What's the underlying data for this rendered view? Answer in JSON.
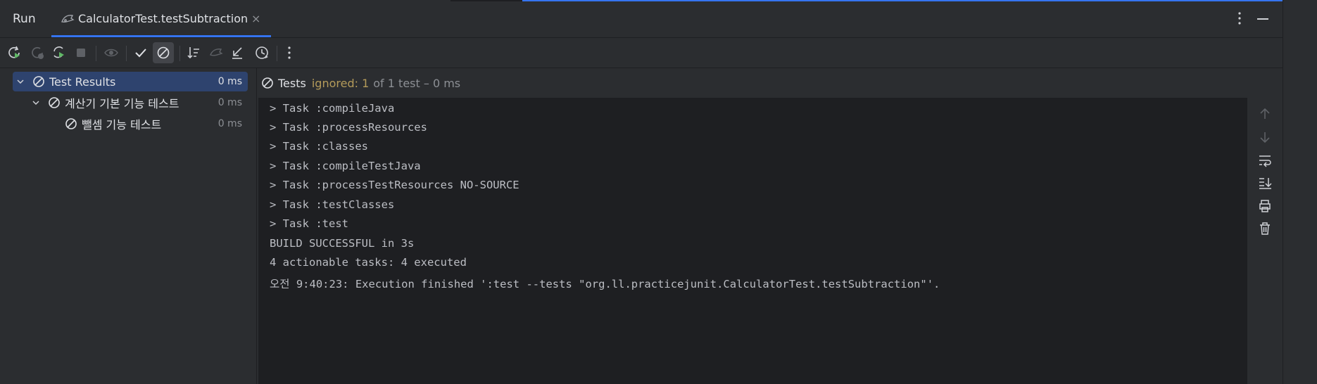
{
  "tabbar": {
    "run_label": "Run",
    "tab_label": "CalculatorTest.testSubtraction",
    "tab_close": "×"
  },
  "toolbar": {
    "buttons": [
      {
        "name": "rerun-icon"
      },
      {
        "name": "rerun-failed-icon"
      },
      {
        "name": "rerun-automatically-icon"
      },
      {
        "name": "stop-icon"
      },
      {
        "name": "show-passed-icon"
      },
      {
        "name": "show-ignored-check-icon"
      },
      {
        "name": "show-ignored-icon"
      },
      {
        "name": "sort-icon"
      },
      {
        "name": "import-tests-icon"
      },
      {
        "name": "collapse-icon"
      },
      {
        "name": "history-icon"
      },
      {
        "name": "more-icon"
      }
    ]
  },
  "tree": {
    "root_label": "Test Results",
    "root_duration": "0 ms",
    "suite_label": "계산기 기본 기능 테스트",
    "suite_duration": "0 ms",
    "test_label": "뺄셈 기능 테스트",
    "test_duration": "0 ms"
  },
  "summary": {
    "tests_label": "Tests",
    "ignored_text": "ignored: 1",
    "rest_text": "of 1 test – 0 ms"
  },
  "console": {
    "lines": [
      "> Task :compileJava",
      "> Task :processResources",
      "> Task :classes",
      "> Task :compileTestJava",
      "> Task :processTestResources NO-SOURCE",
      "> Task :testClasses",
      "> Task :test",
      "BUILD SUCCESSFUL in 3s",
      "4 actionable tasks: 4 executed",
      "오전 9:40:23: Execution finished ':test --tests \"org.ll.practicejunit.CalculatorTest.testSubtraction\"'."
    ]
  },
  "colors": {
    "accent": "#3574f0",
    "selection": "#2e436e",
    "ignored": "#b49b5a",
    "run_green": "#5fb865"
  }
}
